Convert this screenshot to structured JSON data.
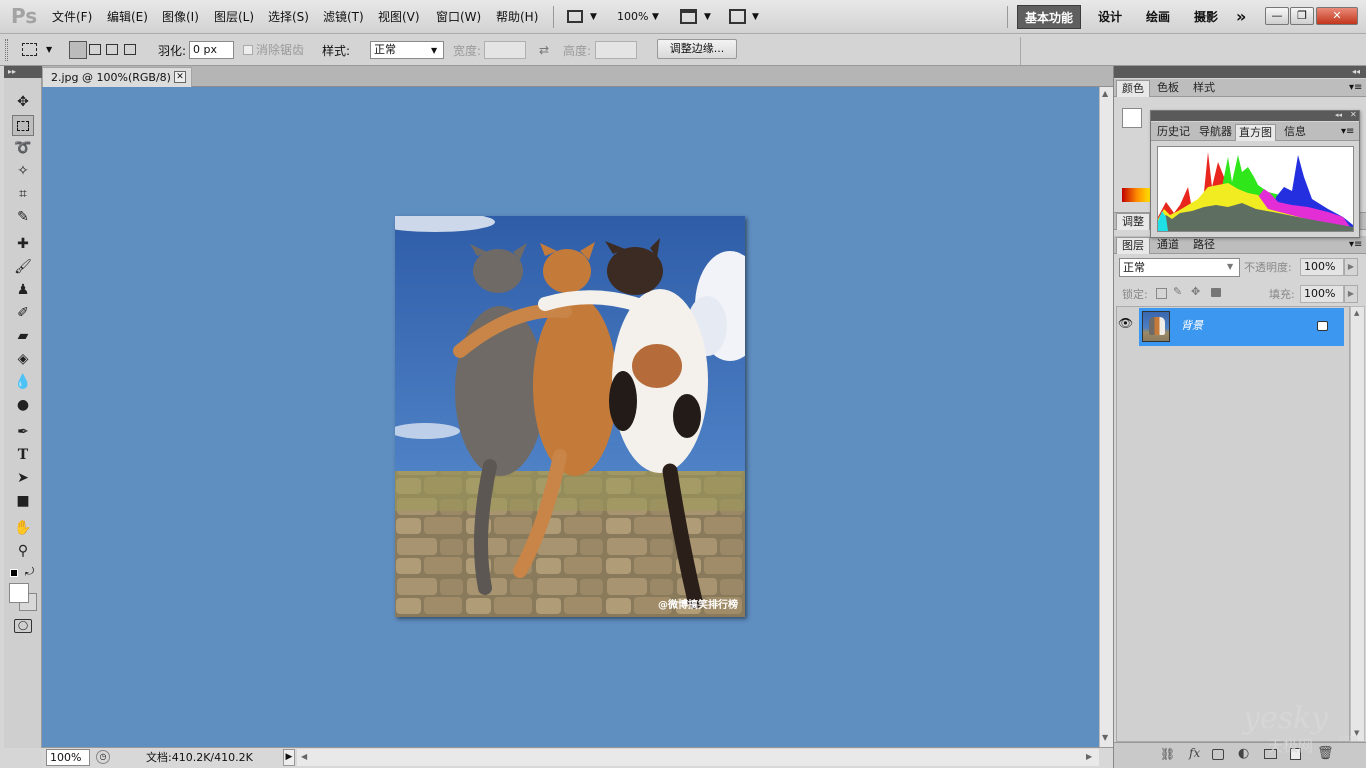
{
  "app": {
    "logo": "Ps"
  },
  "menu": [
    "文件(F)",
    "编辑(E)",
    "图像(I)",
    "图层(L)",
    "选择(S)",
    "滤镜(T)",
    "视图(V)",
    "窗口(W)",
    "帮助(H)"
  ],
  "appbar": {
    "zoom": "100%"
  },
  "workspaces": [
    "基本功能",
    "设计",
    "绘画",
    "摄影"
  ],
  "options": {
    "feather_label": "羽化:",
    "feather_value": "0 px",
    "antialias_label": "消除锯齿",
    "style_label": "样式:",
    "style_value": "正常",
    "width_label": "宽度:",
    "height_label": "高度:",
    "refine_button": "调整边缘..."
  },
  "document": {
    "tab_title": "2.jpg @ 100%(RGB/8)",
    "watermark": "@微博搞笑排行榜"
  },
  "status": {
    "zoom": "100%",
    "doc_info": "文档:410.2K/410.2K"
  },
  "panels": {
    "color_tabs": [
      "颜色",
      "色板",
      "样式"
    ],
    "hist_tabs": [
      "历史记",
      "导航器",
      "直方图",
      "信息"
    ],
    "adjust_tab": "调整",
    "layer_tabs": [
      "图层",
      "通道",
      "路径"
    ],
    "blend_mode": "正常",
    "opacity_label": "不透明度:",
    "opacity_value": "100%",
    "lock_label": "锁定:",
    "fill_label": "填充:",
    "fill_value": "100%",
    "layer_name": "背景"
  },
  "watermark": {
    "brand": "yesky",
    "sub": "天极网",
    "tld": ".com"
  },
  "colors": {
    "canvas_bg": "#5f8ec1",
    "layer_selected": "#3c97f0",
    "active_workspace": "#5f5f5f"
  }
}
